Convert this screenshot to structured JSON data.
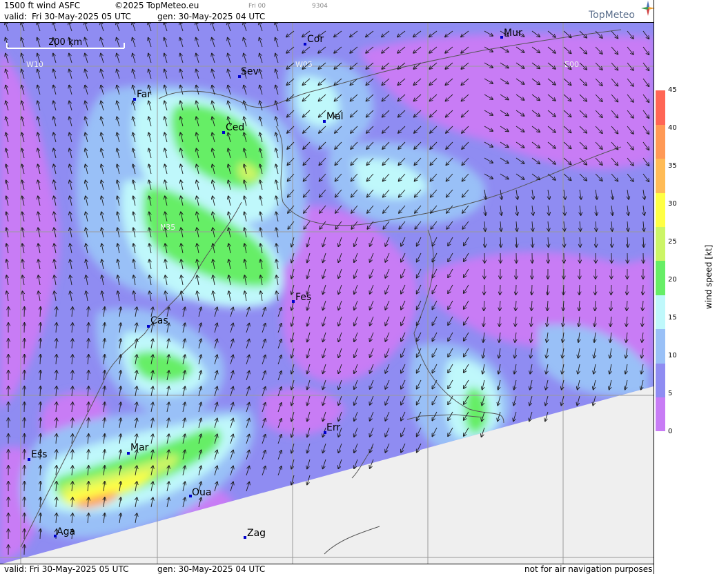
{
  "header": {
    "product": "1500 ft wind ASFC",
    "copyright": "©2025 TopMeteo.eu",
    "valid_label": "valid:",
    "valid_time": "Fri  30-May-2025  05 UTC",
    "gen_time": "gen: 30-May-2025 04 UTC",
    "tiny_day": "Fri 00",
    "tiny_code": "9304"
  },
  "logo": {
    "text": "TopMeteo",
    "icon": "compass-star-icon"
  },
  "scale_bar": {
    "label": "200 km"
  },
  "grid_labels": {
    "w10": "W10",
    "w05": "W05",
    "e00": "E00",
    "n35": "N35"
  },
  "cities": [
    {
      "name": "Cor"
    },
    {
      "name": "Mur"
    },
    {
      "name": "Sev"
    },
    {
      "name": "Far"
    },
    {
      "name": "Mal"
    },
    {
      "name": "Ced"
    },
    {
      "name": "Fes"
    },
    {
      "name": "Cas"
    },
    {
      "name": "Err"
    },
    {
      "name": "Mar"
    },
    {
      "name": "Ess"
    },
    {
      "name": "Oua"
    },
    {
      "name": "Aga"
    },
    {
      "name": "Zag"
    }
  ],
  "legend": {
    "title": "wind speed [kt]",
    "ticks": [
      "45",
      "40",
      "35",
      "30",
      "25",
      "20",
      "15",
      "10",
      "5",
      "0"
    ],
    "colors": [
      "#c87cf5",
      "#8f8cf2",
      "#99c0f7",
      "#bff8fb",
      "#66ee66",
      "#ccf566",
      "#ffff44",
      "#ffbb55",
      "#ff9955",
      "#ff6655"
    ]
  },
  "footer": {
    "valid_time": "valid:  Fri  30-May-2025  05 UTC",
    "gen_time": "gen: 30-May-2025 04 UTC",
    "disclaimer": "not for air navigation purposes"
  }
}
